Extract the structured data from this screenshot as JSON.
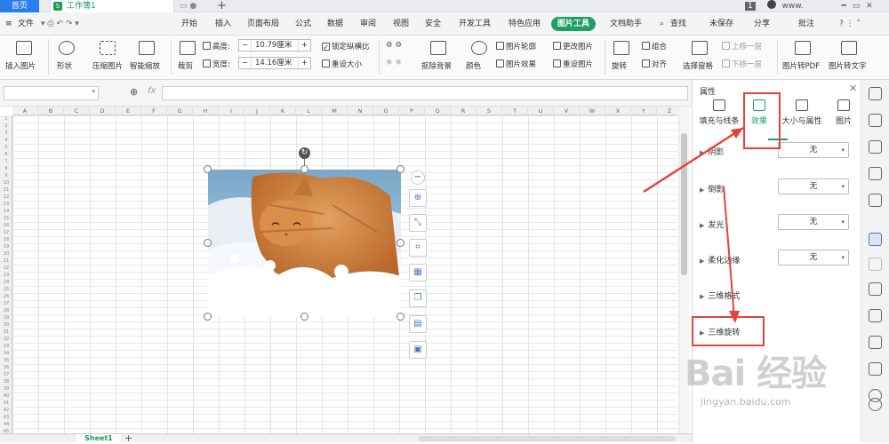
{
  "titlebar": {
    "home_tab": "首页",
    "doc_tab": "工作簿1",
    "doc_badge": "S",
    "tab_icons": "▭ ●",
    "plus": "+",
    "win_badge": "1",
    "user": "www.",
    "win_controls": "━  ▭  ✕"
  },
  "menu": {
    "file": "文件",
    "file_icons": "▾  ⎙ ↶ ↷ ▾",
    "tabs": [
      "开始",
      "插入",
      "页面布局",
      "公式",
      "数据",
      "审阅",
      "视图",
      "安全",
      "开发工具",
      "特色应用",
      "图片工具",
      "文档助手"
    ],
    "search": "查找",
    "unsaved": "未保存",
    "share": "分享",
    "comment": "批注"
  },
  "ribbon": {
    "insert_picture": "插入图片",
    "shape": "形状",
    "compress": "压缩图片",
    "smart_zoom": "智能缩放",
    "crop": "裁剪",
    "height_label": "高度:",
    "height_value": "10.79厘米",
    "width_label": "宽度:",
    "width_value": "14.16厘米",
    "lock_ratio": "锁定纵横比",
    "reset_size": "重设大小",
    "cutout": "抠除背景",
    "color": "颜色",
    "picture_outline": "图片轮廓",
    "picture_effect": "图片效果",
    "change_picture": "更改图片",
    "reset_picture": "重设图片",
    "rotate": "旋转",
    "group": "组合",
    "align": "对齐",
    "selection_pane": "选择窗格",
    "bring_forward": "上移一层",
    "send_backward": "下移一层",
    "to_pdf": "图片转PDF",
    "to_text": "图片转文字"
  },
  "formula": {
    "fx": "fx",
    "zoom_icon": "⊕"
  },
  "sheet": {
    "columns": [
      "A",
      "B",
      "C",
      "D",
      "E",
      "F",
      "G",
      "H",
      "I",
      "J",
      "K",
      "L",
      "M",
      "N",
      "O",
      "P",
      "Q",
      "R",
      "S",
      "T",
      "U",
      "V",
      "W",
      "X",
      "Y",
      "Z"
    ],
    "tab": "Sheet1",
    "add": "+"
  },
  "image": {
    "subject": "orange cat walking in snow"
  },
  "float_toolbar": {
    "zoom": "⊕",
    "crop": "⌗"
  },
  "panel": {
    "title": "属性",
    "close": "✕",
    "tabs": [
      "填充与线条",
      "效果",
      "大小与属性",
      "图片"
    ],
    "rows": [
      {
        "label": "阴影",
        "value": "无"
      },
      {
        "label": "倒影",
        "value": "无"
      },
      {
        "label": "发光",
        "value": "无"
      },
      {
        "label": "柔化边缘",
        "value": "无"
      },
      {
        "label": "三维格式",
        "value": ""
      },
      {
        "label": "三维旋转",
        "value": ""
      }
    ]
  },
  "watermark": {
    "main": "Bai 经验",
    "sub": "jingyan.baidu.com"
  },
  "colors": {
    "accent_green": "#1ea060",
    "highlight_red": "#e8413b",
    "home_blue": "#2b7de9"
  }
}
